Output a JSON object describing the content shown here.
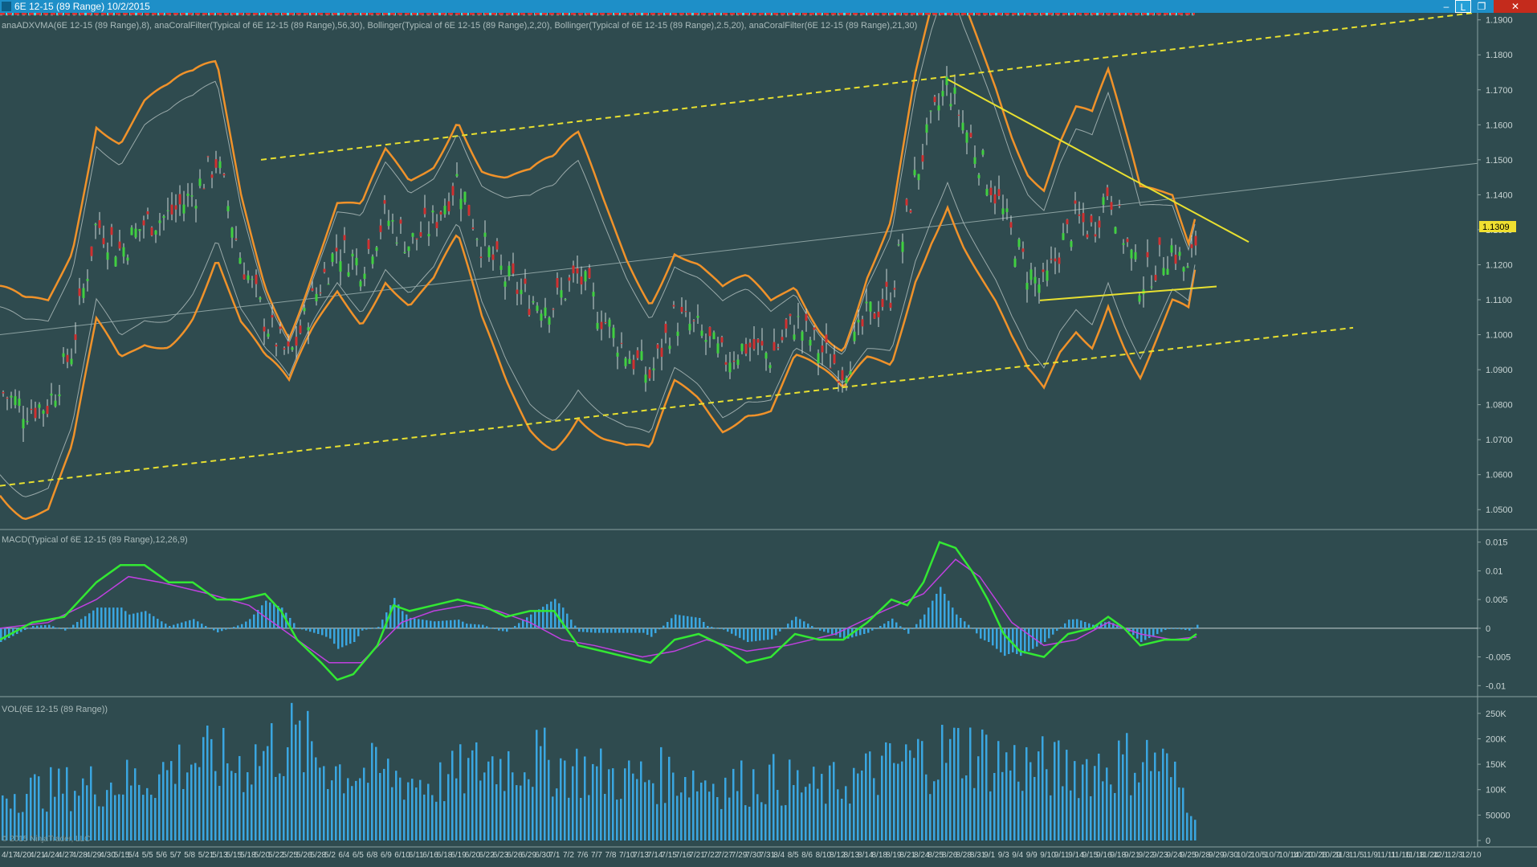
{
  "window": {
    "title": "6E 12-15 (89 Range)  10/2/2015",
    "buttons": [
      "–",
      "L",
      "❐",
      "✕"
    ]
  },
  "panels": {
    "price_label": "anaADXVMA(6E 12-15 (89 Range),8), anaCoralFilter(Typical of 6E 12-15 (89 Range),56,30), Bollinger(Typical of 6E 12-15 (89 Range),2,20), Bollinger(Typical of 6E 12-15 (89 Range),2.5,20), anaCoralFilter(6E 12-15 (89 Range),21,30)",
    "macd_label": "MACD(Typical of 6E 12-15 (89 Range),12,26,9)",
    "vol_label": "VOL(6E 12-15 (89 Range))",
    "copyright": "© 2015 NinjaTrader, LLC",
    "last_price": "1.1309"
  },
  "chart_data": [
    {
      "type": "candlestick",
      "panel": "price",
      "ylim": [
        1.045,
        1.192
      ],
      "yticks": [
        "1.1900",
        "1.1800",
        "1.1700",
        "1.1600",
        "1.1500",
        "1.1400",
        "1.1300",
        "1.1200",
        "1.1100",
        "1.1000",
        "1.0900",
        "1.0800",
        "1.0700",
        "1.0600",
        "1.0500"
      ],
      "last_value": 1.1309,
      "close_path": [
        [
          0,
          1.084
        ],
        [
          30,
          1.079
        ],
        [
          60,
          1.08
        ],
        [
          90,
          1.096
        ],
        [
          120,
          1.132
        ],
        [
          150,
          1.124
        ],
        [
          180,
          1.132
        ],
        [
          210,
          1.134
        ],
        [
          240,
          1.14
        ],
        [
          270,
          1.15
        ],
        [
          300,
          1.122
        ],
        [
          330,
          1.104
        ],
        [
          360,
          1.093
        ],
        [
          390,
          1.11
        ],
        [
          420,
          1.125
        ],
        [
          450,
          1.12
        ],
        [
          480,
          1.134
        ],
        [
          510,
          1.126
        ],
        [
          540,
          1.132
        ],
        [
          570,
          1.145
        ],
        [
          600,
          1.126
        ],
        [
          630,
          1.116
        ],
        [
          660,
          1.11
        ],
        [
          690,
          1.109
        ],
        [
          720,
          1.117
        ],
        [
          750,
          1.105
        ],
        [
          780,
          1.095
        ],
        [
          810,
          1.088
        ],
        [
          840,
          1.105
        ],
        [
          870,
          1.101
        ],
        [
          900,
          1.093
        ],
        [
          930,
          1.097
        ],
        [
          960,
          1.094
        ],
        [
          990,
          1.104
        ],
        [
          1020,
          1.096
        ],
        [
          1050,
          1.09
        ],
        [
          1080,
          1.105
        ],
        [
          1110,
          1.112
        ],
        [
          1140,
          1.145
        ],
        [
          1160,
          1.16
        ],
        [
          1180,
          1.172
        ],
        [
          1200,
          1.16
        ],
        [
          1220,
          1.15
        ],
        [
          1240,
          1.14
        ],
        [
          1260,
          1.128
        ],
        [
          1280,
          1.118
        ],
        [
          1300,
          1.113
        ],
        [
          1320,
          1.125
        ],
        [
          1340,
          1.133
        ],
        [
          1360,
          1.13
        ],
        [
          1380,
          1.142
        ],
        [
          1400,
          1.128
        ],
        [
          1420,
          1.115
        ],
        [
          1440,
          1.12
        ],
        [
          1460,
          1.125
        ],
        [
          1480,
          1.117
        ],
        [
          1490,
          1.128
        ]
      ],
      "indicators": {
        "bollinger_outer": "orange",
        "bollinger_inner": "gray",
        "adxvma": "red/green dashed",
        "coral_56_30": "yellow dotted",
        "coral_21_30": "cyan dotted"
      },
      "drawings": [
        {
          "type": "channel-upper",
          "color": "#e8e030",
          "style": "dashed"
        },
        {
          "type": "channel-lower",
          "color": "#e8e030",
          "style": "dashed"
        },
        {
          "type": "triangle-upper",
          "color": "#e8e030",
          "style": "solid"
        },
        {
          "type": "triangle-lower",
          "color": "#e8e030",
          "style": "solid"
        },
        {
          "type": "regression",
          "color": "#8aa0a0",
          "style": "solid"
        }
      ]
    },
    {
      "type": "macd",
      "panel": "macd",
      "ylim": [
        -0.0115,
        0.0165
      ],
      "yticks": [
        "0.015",
        "0.01",
        "0.005",
        "0",
        "-0.005",
        "-0.01"
      ],
      "macd": [
        [
          0,
          -0.002
        ],
        [
          40,
          0.001
        ],
        [
          80,
          0.002
        ],
        [
          120,
          0.008
        ],
        [
          150,
          0.011
        ],
        [
          180,
          0.011
        ],
        [
          210,
          0.008
        ],
        [
          240,
          0.008
        ],
        [
          270,
          0.005
        ],
        [
          300,
          0.005
        ],
        [
          330,
          0.006
        ],
        [
          350,
          0.003
        ],
        [
          370,
          -0.002
        ],
        [
          400,
          -0.006
        ],
        [
          420,
          -0.009
        ],
        [
          440,
          -0.008
        ],
        [
          470,
          -0.003
        ],
        [
          490,
          0.004
        ],
        [
          510,
          0.003
        ],
        [
          540,
          0.004
        ],
        [
          570,
          0.005
        ],
        [
          600,
          0.004
        ],
        [
          630,
          0.002
        ],
        [
          660,
          0.003
        ],
        [
          690,
          0.003
        ],
        [
          720,
          -0.003
        ],
        [
          750,
          -0.004
        ],
        [
          780,
          -0.005
        ],
        [
          810,
          -0.006
        ],
        [
          840,
          -0.002
        ],
        [
          870,
          -0.001
        ],
        [
          900,
          -0.003
        ],
        [
          930,
          -0.006
        ],
        [
          960,
          -0.005
        ],
        [
          990,
          -0.001
        ],
        [
          1020,
          -0.002
        ],
        [
          1050,
          -0.002
        ],
        [
          1080,
          0.001
        ],
        [
          1110,
          0.005
        ],
        [
          1130,
          0.004
        ],
        [
          1150,
          0.008
        ],
        [
          1170,
          0.015
        ],
        [
          1190,
          0.014
        ],
        [
          1210,
          0.01
        ],
        [
          1230,
          0.005
        ],
        [
          1250,
          -0.001
        ],
        [
          1270,
          -0.004
        ],
        [
          1300,
          -0.005
        ],
        [
          1330,
          -0.001
        ],
        [
          1360,
          0.0
        ],
        [
          1380,
          0.002
        ],
        [
          1400,
          0.0
        ],
        [
          1420,
          -0.003
        ],
        [
          1450,
          -0.002
        ],
        [
          1480,
          -0.002
        ],
        [
          1490,
          -0.001
        ]
      ],
      "signal": [
        [
          0,
          0.0
        ],
        [
          60,
          0.001
        ],
        [
          120,
          0.005
        ],
        [
          160,
          0.009
        ],
        [
          200,
          0.008
        ],
        [
          260,
          0.006
        ],
        [
          310,
          0.004
        ],
        [
          360,
          -0.001
        ],
        [
          410,
          -0.006
        ],
        [
          450,
          -0.006
        ],
        [
          500,
          0.001
        ],
        [
          540,
          0.003
        ],
        [
          580,
          0.004
        ],
        [
          620,
          0.003
        ],
        [
          660,
          0.001
        ],
        [
          700,
          -0.002
        ],
        [
          740,
          -0.003
        ],
        [
          800,
          -0.005
        ],
        [
          840,
          -0.004
        ],
        [
          880,
          -0.002
        ],
        [
          930,
          -0.004
        ],
        [
          980,
          -0.003
        ],
        [
          1040,
          -0.001
        ],
        [
          1100,
          0.003
        ],
        [
          1150,
          0.006
        ],
        [
          1190,
          0.012
        ],
        [
          1220,
          0.009
        ],
        [
          1260,
          0.001
        ],
        [
          1300,
          -0.003
        ],
        [
          1340,
          -0.002
        ],
        [
          1380,
          0.001
        ],
        [
          1420,
          -0.001
        ],
        [
          1460,
          -0.002
        ],
        [
          1490,
          -0.0015
        ]
      ],
      "colors": {
        "macd": "#33e833",
        "signal": "#c040e0",
        "histogram": "#3aa6e0"
      }
    },
    {
      "type": "bar",
      "panel": "volume",
      "ylim": [
        0,
        275000
      ],
      "yticks": [
        "250K",
        "200K",
        "150K",
        "100K",
        "50000",
        "0"
      ],
      "volume_profile": [
        [
          0,
          95000
        ],
        [
          60,
          100000
        ],
        [
          120,
          110000
        ],
        [
          180,
          120000
        ],
        [
          240,
          160000
        ],
        [
          300,
          150000
        ],
        [
          360,
          200000
        ],
        [
          420,
          140000
        ],
        [
          480,
          130000
        ],
        [
          540,
          110000
        ],
        [
          600,
          150000
        ],
        [
          660,
          160000
        ],
        [
          720,
          140000
        ],
        [
          780,
          120000
        ],
        [
          840,
          130000
        ],
        [
          900,
          110000
        ],
        [
          960,
          120000
        ],
        [
          1020,
          100000
        ],
        [
          1080,
          130000
        ],
        [
          1140,
          160000
        ],
        [
          1200,
          180000
        ],
        [
          1260,
          150000
        ],
        [
          1320,
          140000
        ],
        [
          1380,
          150000
        ],
        [
          1440,
          160000
        ],
        [
          1490,
          60000
        ]
      ],
      "color": "#3aa6e0"
    }
  ],
  "x_axis": {
    "labels": [
      "4/17",
      "4/20",
      "4/21",
      "4/24",
      "4/27",
      "4/28",
      "4/29",
      "4/30",
      "5/15",
      "5/4",
      "5/5",
      "5/6",
      "5/7",
      "5/8",
      "5/21",
      "5/13",
      "5/15",
      "5/18",
      "5/20",
      "5/22",
      "5/25",
      "5/26",
      "5/28",
      "5/2",
      "6/4",
      "6/5",
      "6/8",
      "6/9",
      "6/10",
      "6/11",
      "6/16",
      "6/18",
      "6/19",
      "6/20",
      "6/22",
      "6/23",
      "6/26",
      "6/29",
      "6/30",
      "7/1",
      "7/2",
      "7/6",
      "7/7",
      "7/8",
      "7/10",
      "7/13",
      "7/14",
      "7/15",
      "7/16",
      "7/21",
      "7/22",
      "7/27",
      "7/29",
      "7/30",
      "7/31",
      "8/4",
      "8/5",
      "8/6",
      "8/10",
      "8/12",
      "8/13",
      "8/14",
      "8/18",
      "8/19",
      "8/21",
      "8/24",
      "8/25",
      "8/26",
      "8/28",
      "8/31",
      "9/1",
      "9/3",
      "9/4",
      "9/9",
      "9/10",
      "9/11",
      "9/14",
      "9/15",
      "9/16",
      "9/18",
      "9/21",
      "9/22",
      "9/23",
      "9/24",
      "9/25",
      "9/28",
      "9/29",
      "9/30",
      "10/2",
      "10/5",
      "10/7",
      "10/14",
      "10/20",
      "10/26",
      "10/29",
      "11/3",
      "11/5",
      "11/9",
      "11/11",
      "11/16",
      "11/18",
      "11/24",
      "12/1",
      "12/3",
      "12/10"
    ]
  }
}
